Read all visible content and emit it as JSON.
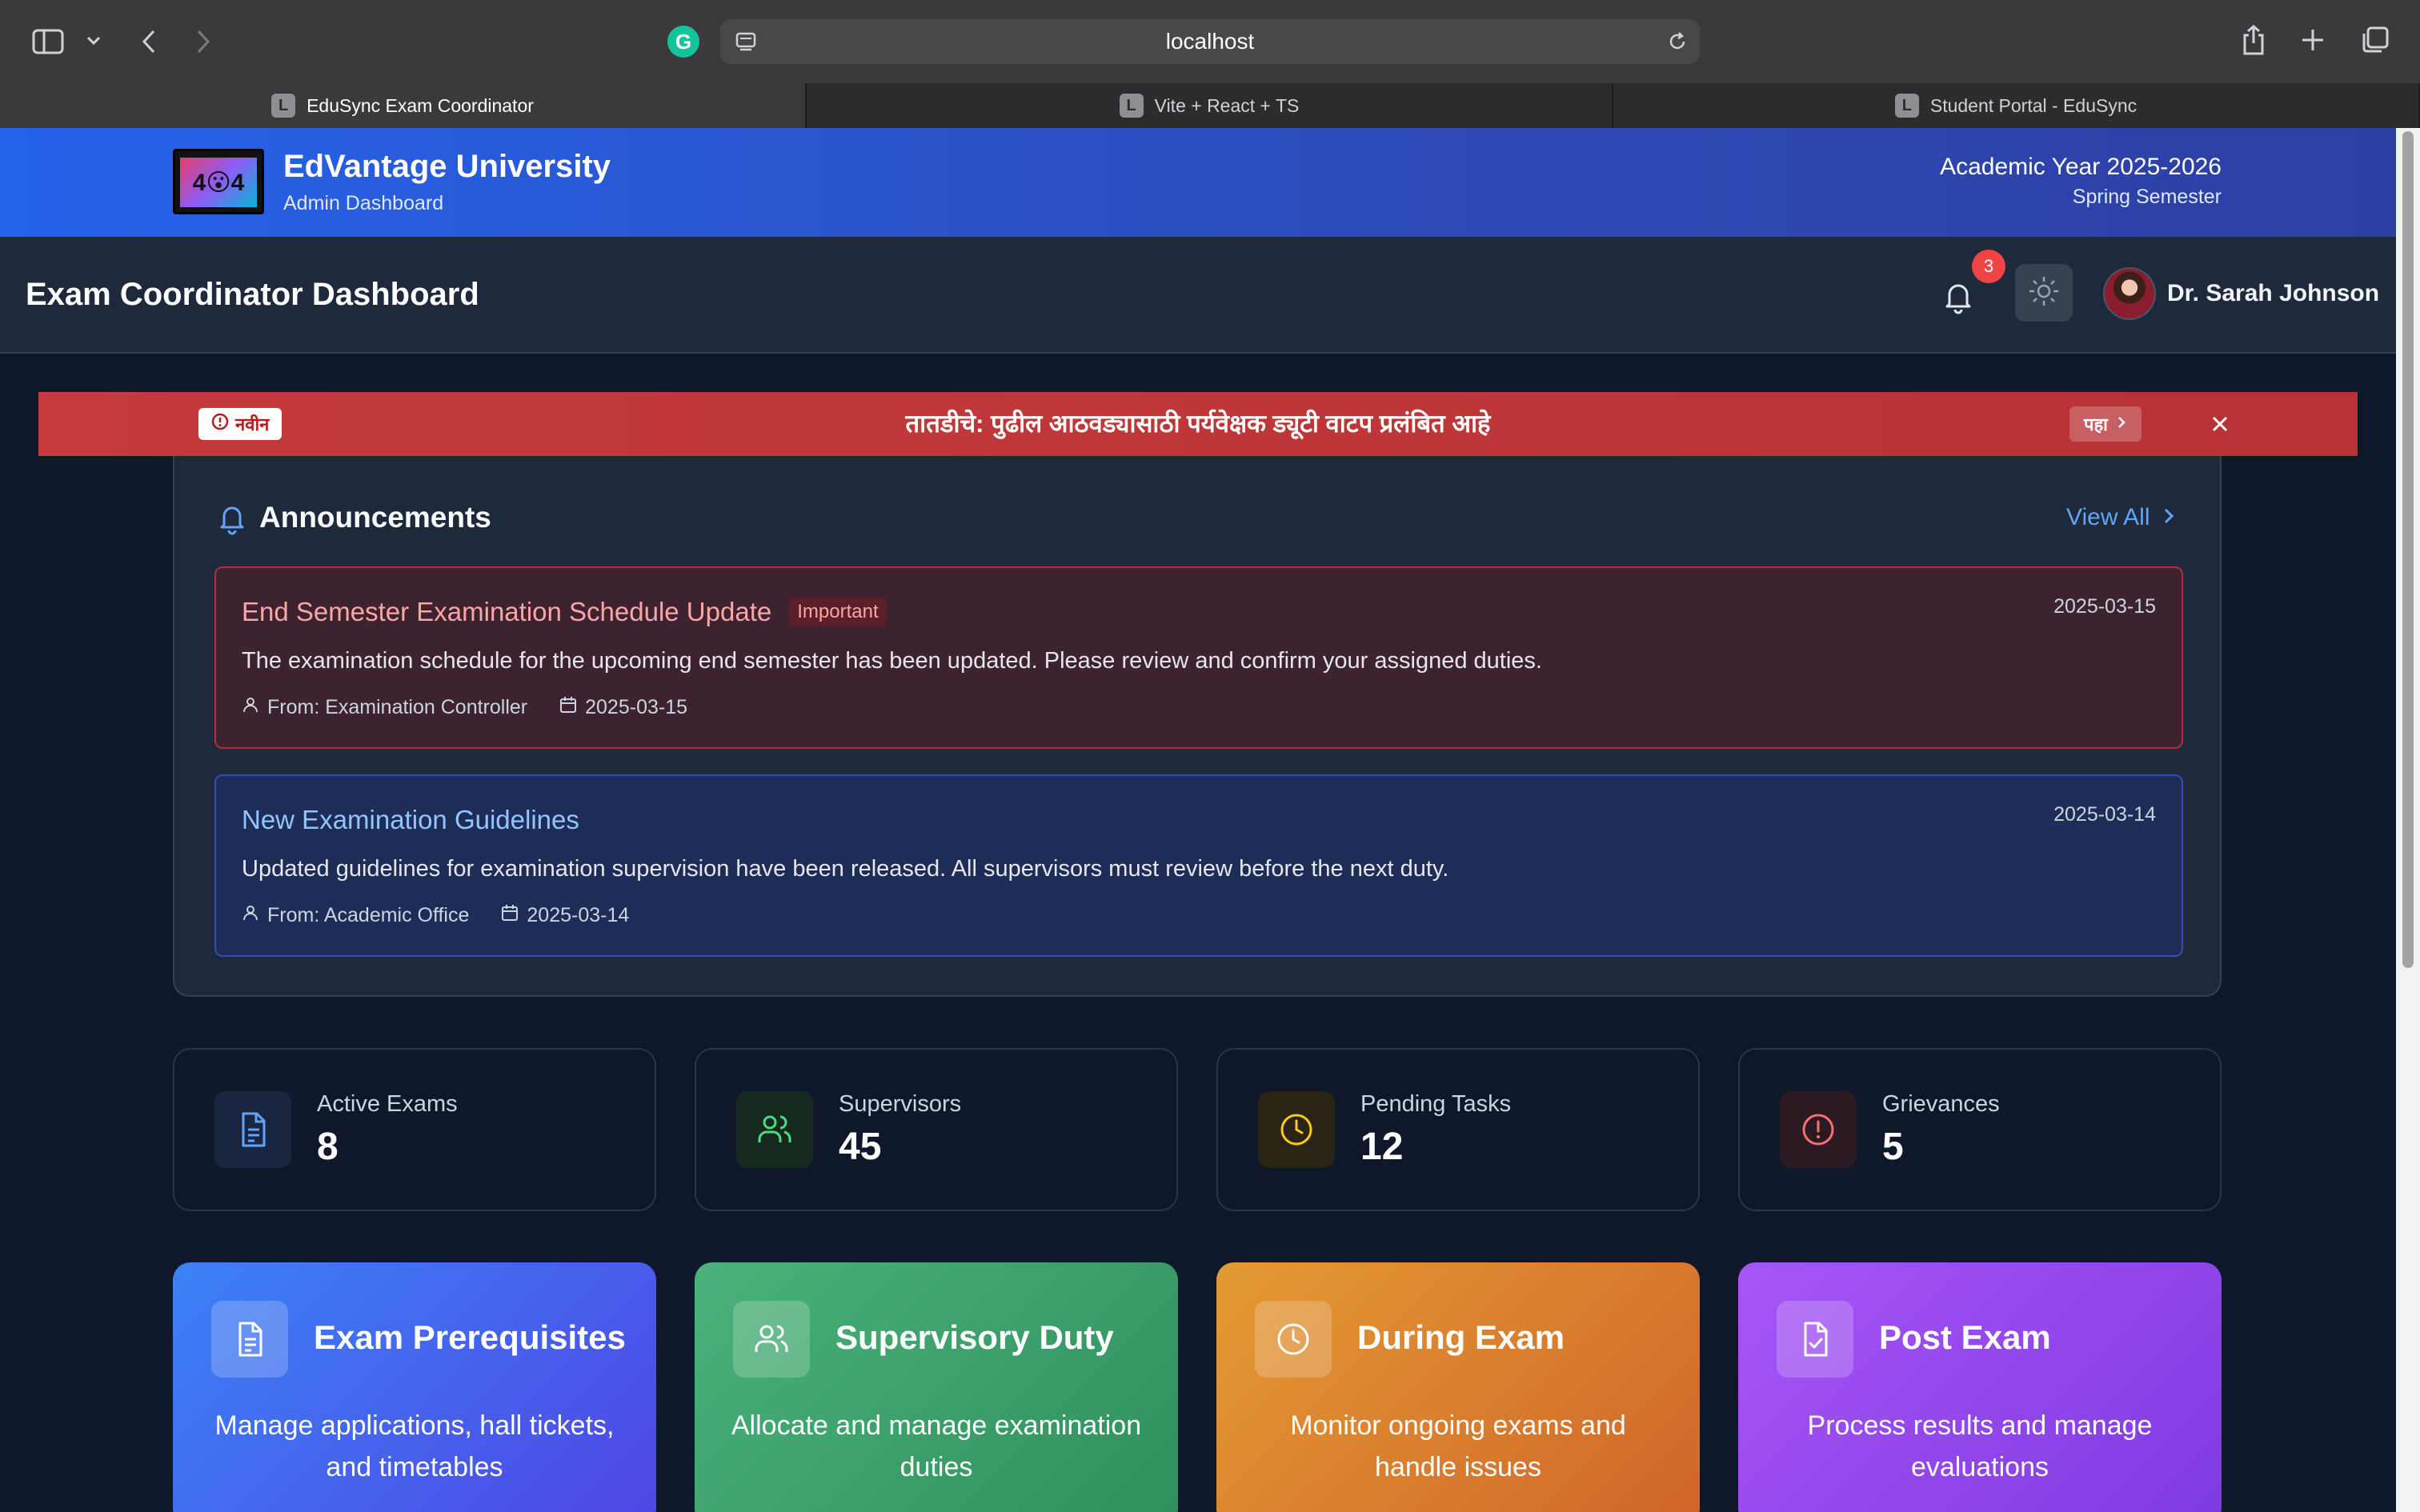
{
  "browser": {
    "url": "localhost",
    "tabs": [
      {
        "label": "EduSync Exam Coordinator",
        "favicon": "L"
      },
      {
        "label": "Vite + React + TS",
        "favicon": "L"
      },
      {
        "label": "Student Portal - EduSync",
        "favicon": "L"
      }
    ],
    "extension_letter": "G"
  },
  "university": {
    "logo_text": "4😮4",
    "name": "EdVantage University",
    "subtitle": "Admin Dashboard",
    "academic_year": "Academic Year 2025-2026",
    "semester": "Spring Semester"
  },
  "dashboard": {
    "title": "Exam Coordinator Dashboard",
    "notification_count": "3",
    "user_name": "Dr. Sarah Johnson"
  },
  "banner": {
    "tag": "नवीन",
    "text": "तातडीचे: पुढील आठवड्यासाठी पर्यवेक्षक ड्यूटी वाटप प्रलंबित आहे",
    "view_label": "पहा",
    "color": "#c53b3b"
  },
  "announcements": {
    "title": "Announcements",
    "view_all": "View All",
    "items": [
      {
        "title": "End Semester Examination Schedule Update",
        "tag": "Important",
        "date": "2025-03-15",
        "body": "The examination schedule for the upcoming end semester has been updated. Please review and confirm your assigned duties.",
        "from": "From: Examination Controller",
        "meta_date": "2025-03-15"
      },
      {
        "title": "New Examination Guidelines",
        "date": "2025-03-14",
        "body": "Updated guidelines for examination supervision have been released. All supervisors must review before the next duty.",
        "from": "From: Academic Office",
        "meta_date": "2025-03-14"
      }
    ]
  },
  "stats": [
    {
      "label": "Active Exams",
      "value": "8",
      "icon": "document-icon",
      "color": "#60a5fa"
    },
    {
      "label": "Supervisors",
      "value": "45",
      "icon": "users-icon",
      "color": "#4ade80"
    },
    {
      "label": "Pending Tasks",
      "value": "12",
      "icon": "clock-icon",
      "color": "#facc15"
    },
    {
      "label": "Grievances",
      "value": "5",
      "icon": "alert-circle-icon",
      "color": "#f87171"
    }
  ],
  "modules": [
    {
      "title": "Exam Prerequisites",
      "desc": "Manage applications, hall tickets, and timetables",
      "icon": "document-icon"
    },
    {
      "title": "Supervisory Duty",
      "desc": "Allocate and manage examination duties",
      "icon": "users-icon"
    },
    {
      "title": "During Exam",
      "desc": "Monitor ongoing exams and handle issues",
      "icon": "clock-icon"
    },
    {
      "title": "Post Exam",
      "desc": "Process results and manage evaluations",
      "icon": "file-check-icon"
    }
  ]
}
